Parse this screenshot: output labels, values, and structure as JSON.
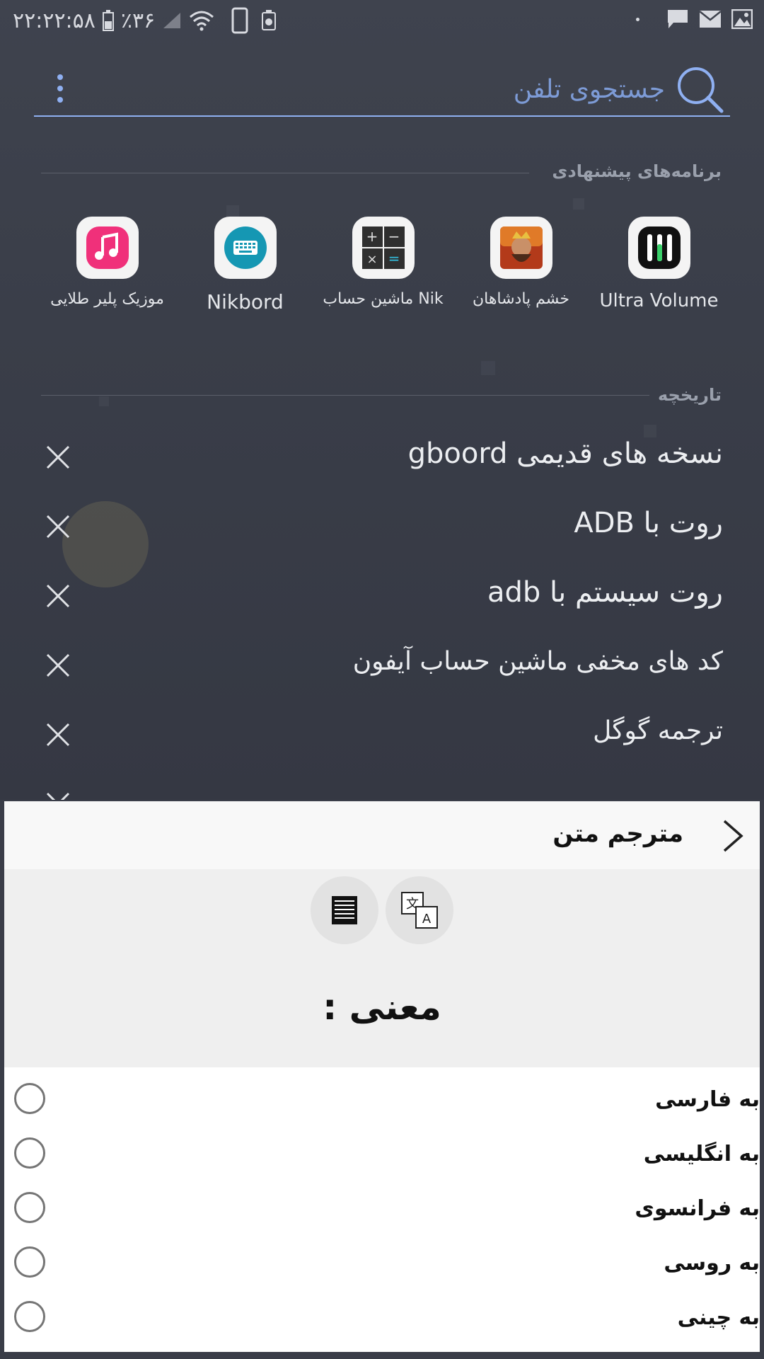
{
  "status_bar": {
    "time": "۲۲:۲۲:۵۸",
    "battery": "٪۳۶"
  },
  "search": {
    "placeholder": "جستجوی تلفن"
  },
  "suggested": {
    "title": "برنامه‌های پیشنهادی",
    "apps": [
      {
        "label": "Ultra Volume",
        "icon": "equalizer-icon"
      },
      {
        "label": "خشم پادشاهان",
        "icon": "king-game-icon"
      },
      {
        "label": "ماشین حساب Nik",
        "icon": "calculator-icon"
      },
      {
        "label": "Nikbord",
        "icon": "keyboard-icon"
      },
      {
        "label": "موزیک پلیر طلایی",
        "icon": "music-icon"
      }
    ]
  },
  "history": {
    "title": "تاریخچه",
    "items": [
      "نسخه های قدیمی gboord",
      "روت با ADB",
      "روت سیستم با adb",
      "کد های مخفی ماشین حساب آیفون",
      "ترجمه گوگل"
    ]
  },
  "translator": {
    "title": "مترجم متن",
    "meaning_label": "معنی :",
    "languages": [
      "به فارسی",
      "به انگلیسی",
      "به فرانسوی",
      "به روسی",
      "به چینی"
    ]
  },
  "colors": {
    "accent": "#8fb0f2",
    "background": "#3a3d48",
    "panel": "#efefef"
  }
}
